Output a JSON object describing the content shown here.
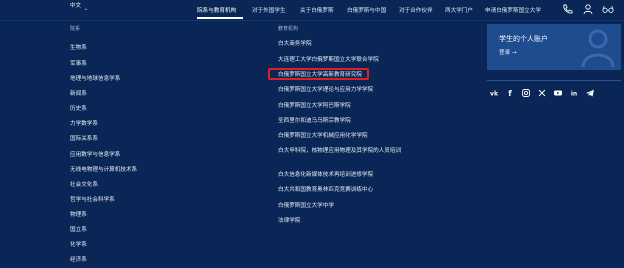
{
  "language": {
    "label": "中文"
  },
  "nav": {
    "items": [
      "院系与教育机构",
      "对于外国学生",
      "关于白俄罗斯",
      "白俄罗斯与中国",
      "对于合作伙伴",
      "两大学门户",
      "申请白俄罗斯国立大学"
    ]
  },
  "faculties": {
    "heading": "院系",
    "items": [
      "生物系",
      "军事系",
      "地理与地球信息学系",
      "新闻系",
      "历史系",
      "力学数学系",
      "国际关系系",
      "应用数学与信息学系",
      "无线电物理与计算机技术系",
      "社会文化系",
      "哲学与社会科学系",
      "物理系",
      "国立系",
      "化学系",
      "经济系"
    ]
  },
  "institutions": {
    "heading": "教育机构",
    "items": [
      "白大商务学院",
      "大连理工大学白俄罗斯国立大学联合学院",
      "白俄罗斯国立大学高新教育研究院",
      "白俄罗斯国立大学理论与应用力学学院",
      "白俄罗斯国立大学阿巴斯学院",
      "圣西里尔和迪马乌斯宗教学院",
      "白俄罗斯国立大学机械应用化学学院",
      "白大甲科院，核物理应用物理及其学院的人员培训",
      "白大信息化新媒体技术再培训进修学院",
      "白大共和国教育奥林匹克竞赛训练中心",
      "白俄罗斯国立大学中学",
      "法律学院"
    ]
  },
  "account": {
    "title": "学生的个人账户",
    "login": "登录"
  },
  "social": [
    "vk-icon",
    "facebook-icon",
    "instagram-icon",
    "x-icon",
    "youtube-icon",
    "linkedin-icon",
    "telegram-icon"
  ],
  "colors": {
    "background": "#0a2656",
    "card": "#1f4b8f",
    "highlight": "#e02020"
  }
}
